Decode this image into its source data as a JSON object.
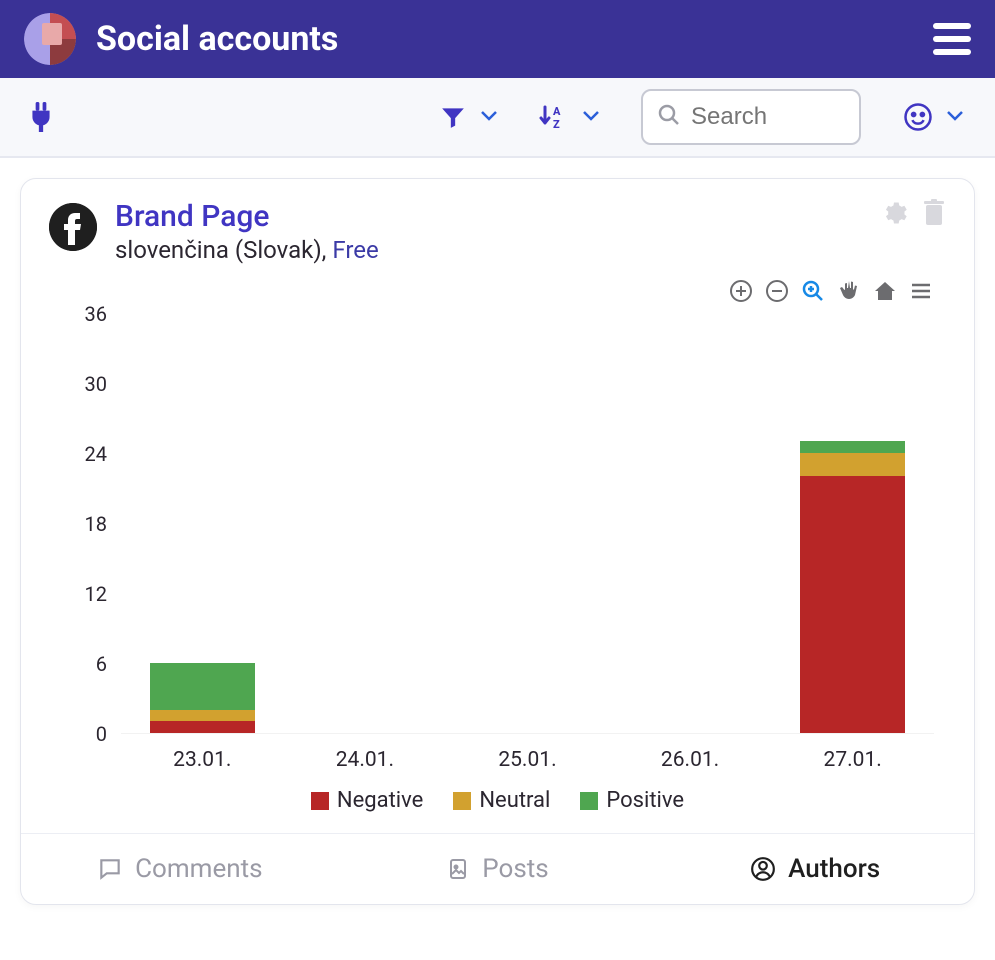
{
  "header": {
    "title": "Social accounts"
  },
  "toolbar": {
    "search_placeholder": "Search"
  },
  "card": {
    "title": "Brand Page",
    "language": "slovenčina (Slovak), ",
    "plan": "Free"
  },
  "chart_data": {
    "type": "bar",
    "categories": [
      "23.01.",
      "24.01.",
      "25.01.",
      "26.01.",
      "27.01."
    ],
    "series": [
      {
        "name": "Negative",
        "values": [
          1,
          0,
          0,
          0,
          22
        ]
      },
      {
        "name": "Neutral",
        "values": [
          1,
          0,
          0,
          0,
          2
        ]
      },
      {
        "name": "Positive",
        "values": [
          4,
          0,
          0,
          0,
          1
        ]
      }
    ],
    "ylim": [
      0,
      36
    ],
    "yticks": [
      0,
      6,
      12,
      18,
      24,
      30,
      36
    ],
    "colors": {
      "Negative": "#b72626",
      "Neutral": "#d2a12f",
      "Positive": "#4fa650"
    },
    "legend": [
      "Negative",
      "Neutral",
      "Positive"
    ],
    "xlabel": "",
    "ylabel": "",
    "title": ""
  },
  "tabs": {
    "comments": "Comments",
    "posts": "Posts",
    "authors": "Authors",
    "active": "authors"
  }
}
